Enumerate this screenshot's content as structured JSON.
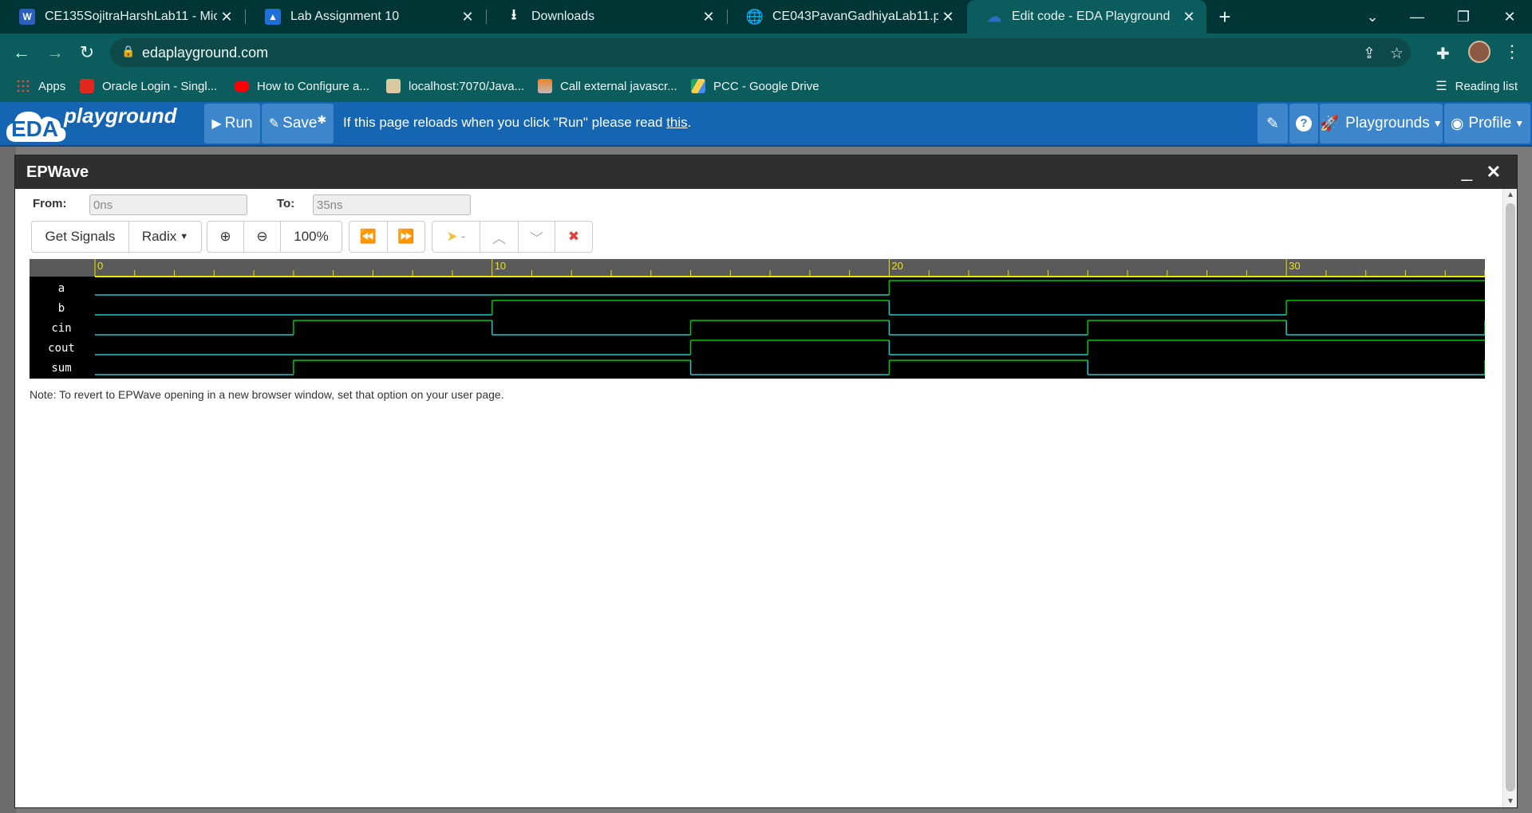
{
  "browser": {
    "tabs": [
      {
        "title": "CE135SojitraHarshLab11 - Micros",
        "icon": "word-icon"
      },
      {
        "title": "Lab Assignment 10",
        "icon": "classroom-icon"
      },
      {
        "title": "Downloads",
        "icon": "download-icon"
      },
      {
        "title": "CE043PavanGadhiyaLab11.pdf",
        "icon": "globe-icon"
      },
      {
        "title": "Edit code - EDA Playground",
        "icon": "eda-cloud-icon"
      }
    ],
    "url": "edaplayground.com",
    "bookmarks": [
      {
        "label": "Apps",
        "icon": "apps-grid-icon"
      },
      {
        "label": "Oracle Login - Singl...",
        "icon": "oracle-icon"
      },
      {
        "label": "How to Configure a...",
        "icon": "youtube-icon"
      },
      {
        "label": "localhost:7070/Java...",
        "icon": "bookmark-page-icon"
      },
      {
        "label": "Call external javascr...",
        "icon": "stackoverflow-icon"
      },
      {
        "label": "PCC - Google Drive",
        "icon": "google-drive-icon"
      }
    ],
    "reading_list": "Reading list"
  },
  "eda": {
    "logo_left": "EDA",
    "logo_right": "playground",
    "run_label": "Run",
    "save_label": "Save",
    "message_before": "If this page reloads when you click \"Run\" please read ",
    "message_link": "this",
    "message_after": ".",
    "playgrounds_label": "Playgrounds",
    "profile_label": "Profile"
  },
  "epwave": {
    "title": "EPWave",
    "from_label": "From:",
    "from_value": "0ns",
    "to_label": "To:",
    "to_value": "35ns",
    "get_signals_label": "Get Signals",
    "radix_label": "Radix",
    "zoom_label": "100%",
    "marker_label": "-",
    "note": "Note: To revert to EPWave opening in a new browser window, set that option on your user page."
  },
  "chart_data": {
    "type": "waveform",
    "x_range": [
      0,
      35
    ],
    "x_unit": "ns",
    "tick_labels": [
      "0",
      "10",
      "20",
      "30"
    ],
    "signals": [
      {
        "name": "a",
        "transitions": [
          [
            0,
            0
          ],
          [
            20,
            1
          ]
        ]
      },
      {
        "name": "b",
        "transitions": [
          [
            0,
            0
          ],
          [
            10,
            1
          ],
          [
            20,
            0
          ],
          [
            30,
            1
          ]
        ]
      },
      {
        "name": "cin",
        "transitions": [
          [
            0,
            0
          ],
          [
            5,
            1
          ],
          [
            10,
            0
          ],
          [
            15,
            1
          ],
          [
            20,
            0
          ],
          [
            25,
            1
          ],
          [
            30,
            0
          ],
          [
            35,
            1
          ]
        ]
      },
      {
        "name": "cout",
        "transitions": [
          [
            0,
            0
          ],
          [
            15,
            1
          ],
          [
            20,
            0
          ],
          [
            25,
            1
          ]
        ]
      },
      {
        "name": "sum",
        "transitions": [
          [
            0,
            0
          ],
          [
            5,
            1
          ],
          [
            15,
            0
          ],
          [
            20,
            1
          ],
          [
            25,
            0
          ],
          [
            35,
            1
          ]
        ]
      }
    ],
    "colors": {
      "high": "#00c800",
      "low": "#22c8c8",
      "background": "#000000",
      "ruler": "#5a5a5a",
      "tick": "#e8e800"
    }
  }
}
